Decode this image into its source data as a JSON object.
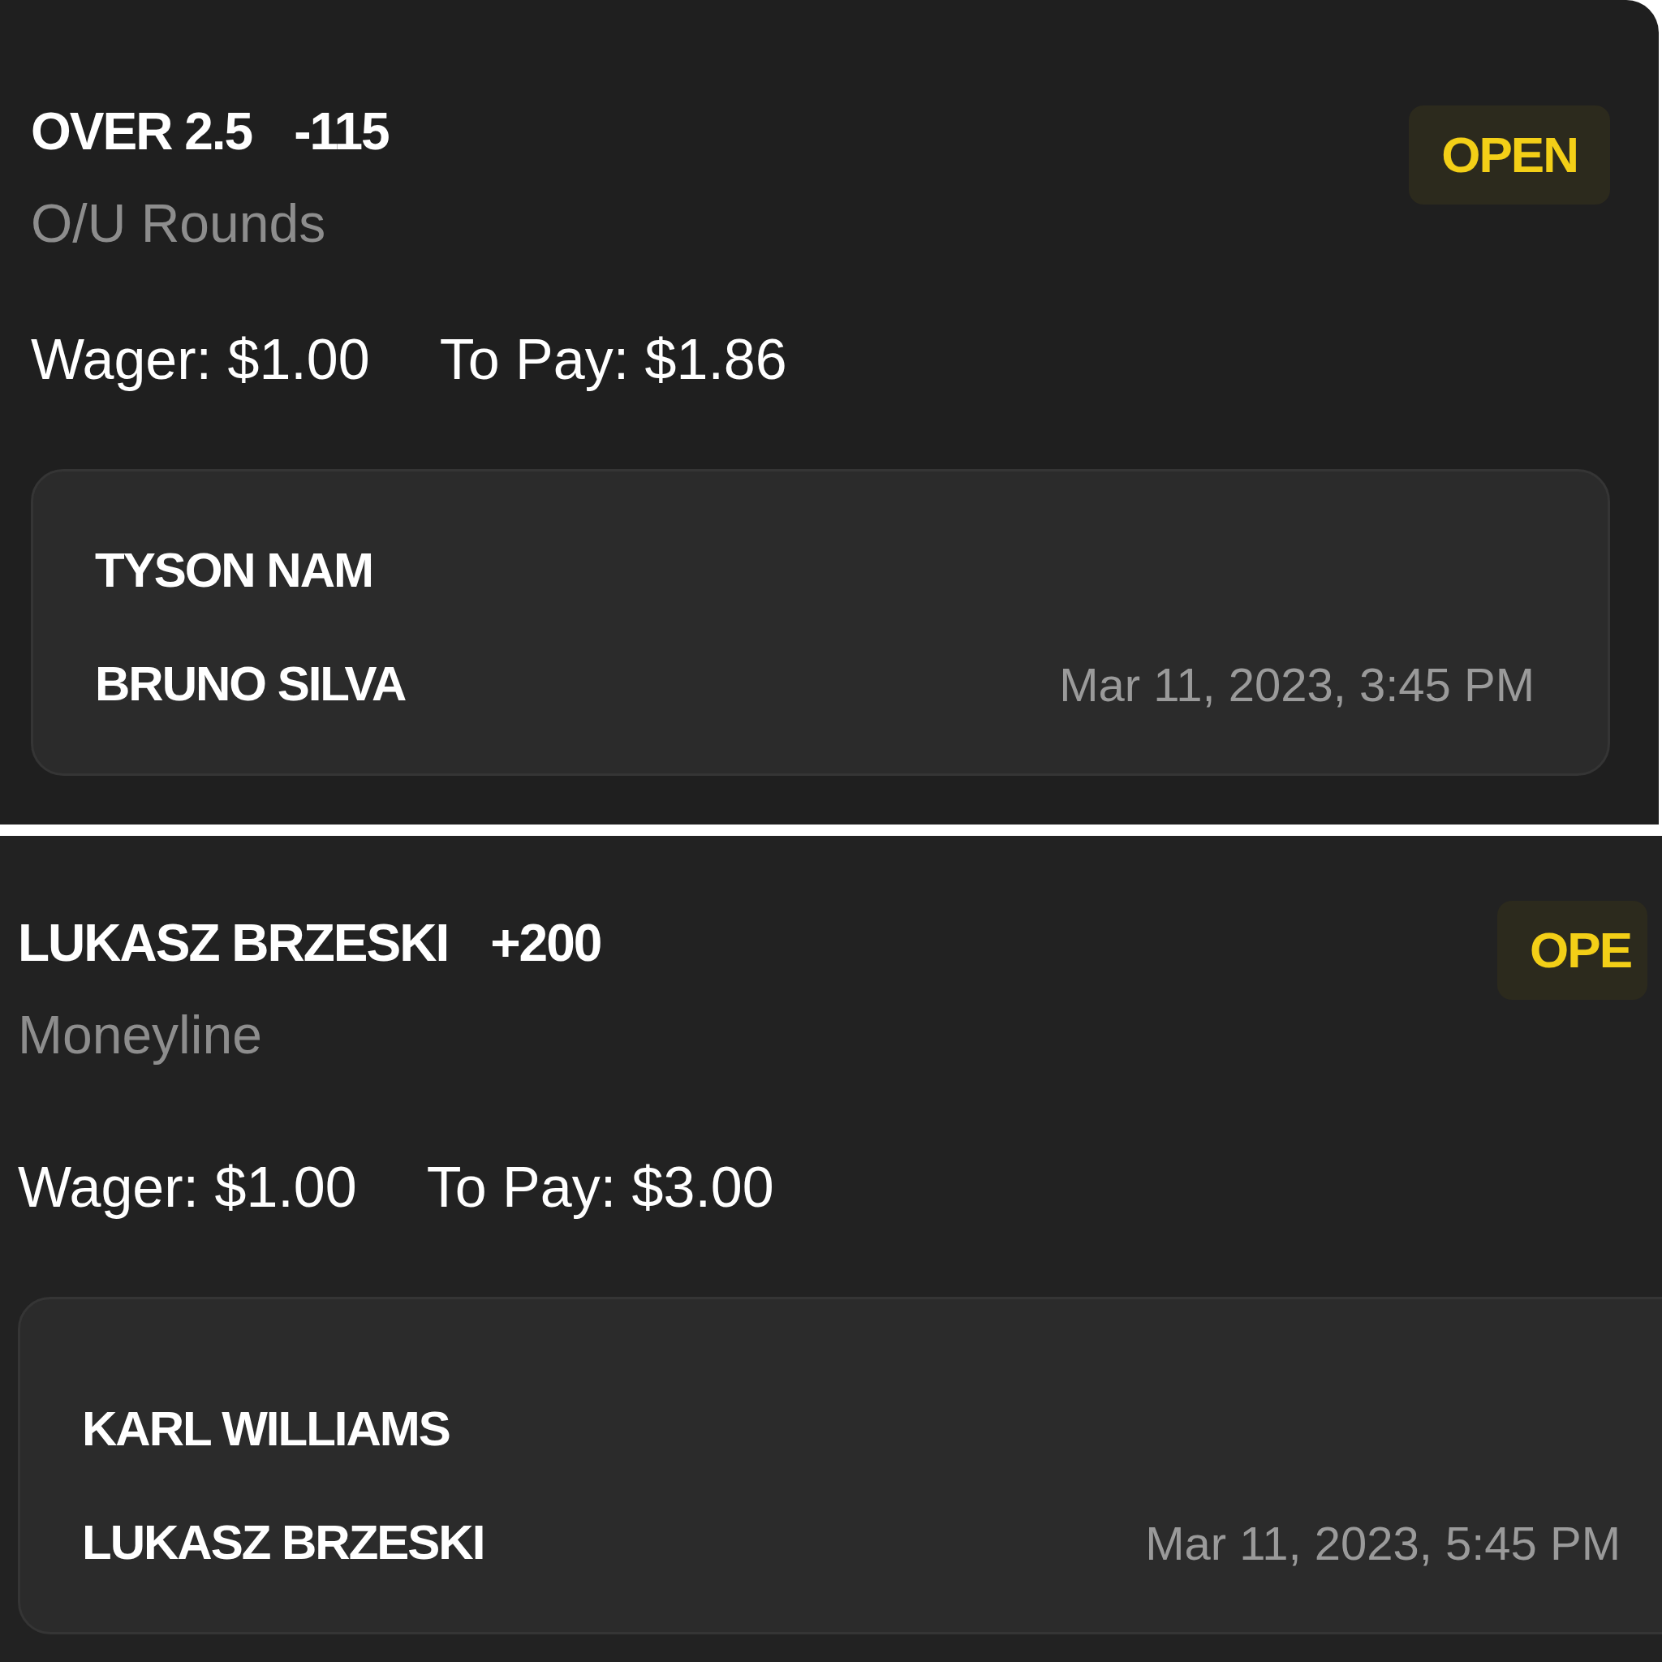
{
  "bets": [
    {
      "selection": "OVER 2.5",
      "odds": "-115",
      "status": "OPEN",
      "market": "O/U Rounds",
      "wager": "Wager: $1.00",
      "to_pay": "To Pay: $1.86",
      "fighters": [
        "TYSON NAM",
        "BRUNO SILVA"
      ],
      "date": "Mar 11, 2023, 3:45 PM"
    },
    {
      "selection": "LUKASZ BRZESKI",
      "odds": "+200",
      "status": "OPE",
      "market": "Moneyline",
      "wager": "Wager: $1.00",
      "to_pay": "To Pay: $3.00",
      "fighters": [
        "KARL WILLIAMS",
        "LUKASZ BRZESKI"
      ],
      "date": "Mar 11, 2023, 5:45 PM"
    }
  ]
}
